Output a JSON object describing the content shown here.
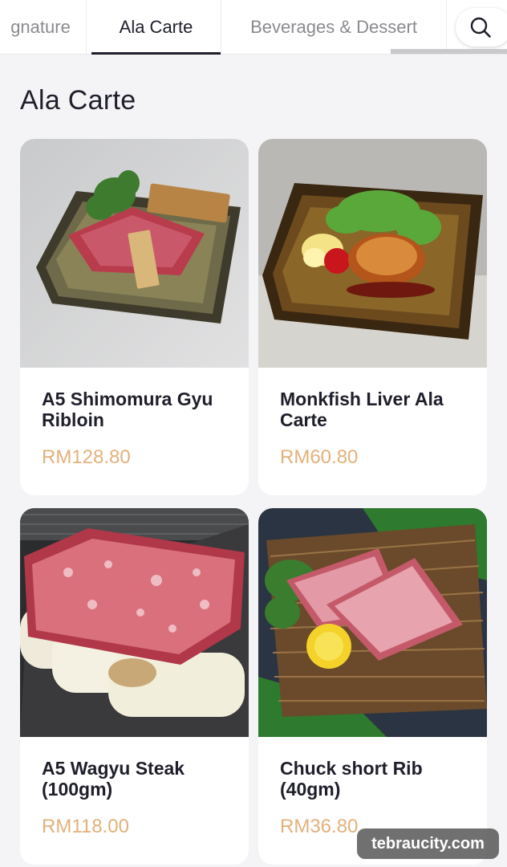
{
  "tabs": [
    {
      "label": "gnature"
    },
    {
      "label": "Ala Carte"
    },
    {
      "label": "Beverages & Dessert"
    }
  ],
  "search_icon": "search-icon",
  "section_title": "Ala Carte",
  "items": [
    {
      "name": "A5 Shimomura Gyu Ribloin",
      "price": "RM128.80",
      "image": "wagyu-plate-photo"
    },
    {
      "name": "Monkfish Liver Ala Carte",
      "price": "RM60.80",
      "image": "monkfish-liver-plate-photo"
    },
    {
      "name": "A5 Wagyu Steak (100gm)",
      "price": "RM118.00",
      "image": "wagyu-steak-photo"
    },
    {
      "name": "Chuck short Rib (40gm)",
      "price": "RM36.80",
      "image": "chuck-short-rib-photo"
    }
  ],
  "watermark": "tebraucity.com",
  "colors": {
    "price": "#e3b07a",
    "active_tab": "#1f1f2b",
    "inactive_tab": "#8a8a90",
    "background": "#f4f4f6"
  }
}
